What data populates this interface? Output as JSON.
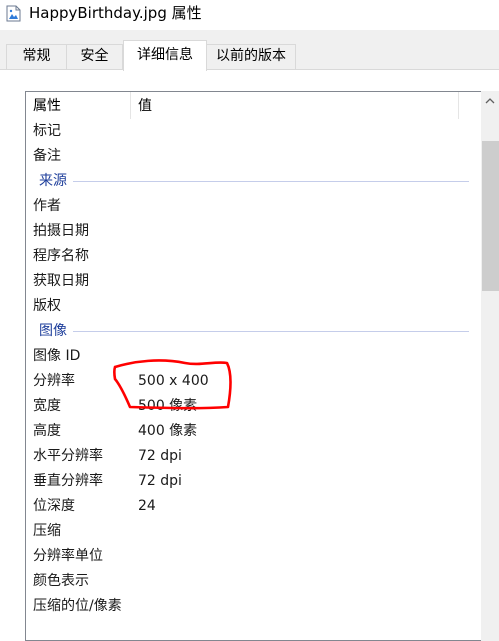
{
  "window": {
    "title": "HappyBirthday.jpg 属性",
    "icon": "image-file-icon"
  },
  "tabs": [
    {
      "label": "常规"
    },
    {
      "label": "安全"
    },
    {
      "label": "详细信息",
      "active": true
    },
    {
      "label": "以前的版本"
    }
  ],
  "details": {
    "headers": {
      "property": "属性",
      "value": "值"
    },
    "rows": [
      {
        "label": "标记",
        "value": ""
      },
      {
        "label": "备注",
        "value": ""
      },
      {
        "group": "来源"
      },
      {
        "label": "作者",
        "value": ""
      },
      {
        "label": "拍摄日期",
        "value": ""
      },
      {
        "label": "程序名称",
        "value": ""
      },
      {
        "label": "获取日期",
        "value": ""
      },
      {
        "label": "版权",
        "value": ""
      },
      {
        "group": "图像"
      },
      {
        "label": "图像 ID",
        "value": ""
      },
      {
        "label": "分辨率",
        "value": "500 x 400"
      },
      {
        "label": "宽度",
        "value": "500 像素"
      },
      {
        "label": "高度",
        "value": "400 像素"
      },
      {
        "label": "水平分辨率",
        "value": "72 dpi"
      },
      {
        "label": "垂直分辨率",
        "value": "72 dpi"
      },
      {
        "label": "位深度",
        "value": "24"
      },
      {
        "label": "压缩",
        "value": ""
      },
      {
        "label": "分辨率单位",
        "value": ""
      },
      {
        "label": "颜色表示",
        "value": ""
      },
      {
        "label": "压缩的位/像素",
        "value": ""
      }
    ]
  },
  "colors": {
    "group_text": "#1e3e9b",
    "annotation": "#ff0000"
  }
}
